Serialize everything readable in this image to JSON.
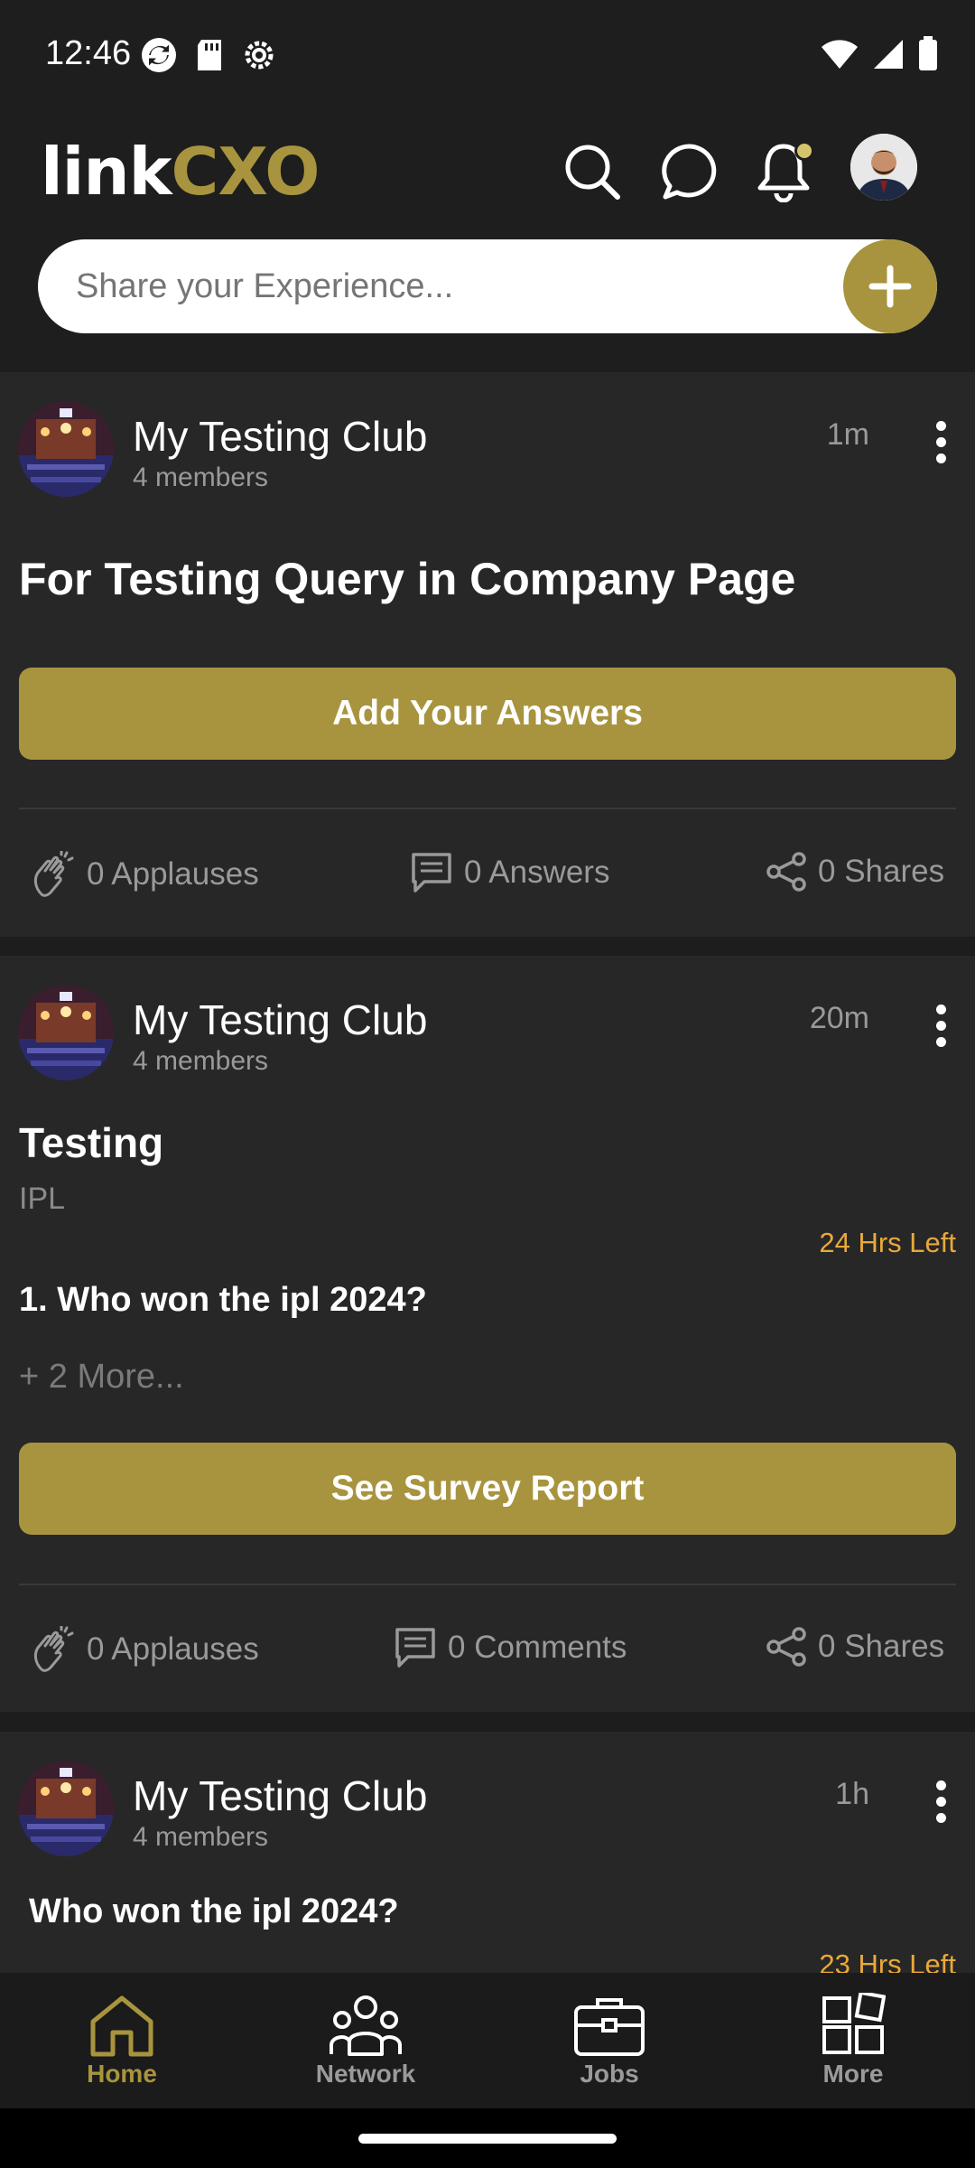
{
  "status_bar": {
    "time": "12:46"
  },
  "header": {
    "logo_left": "link",
    "logo_right": "CXO",
    "share_placeholder": "Share your Experience..."
  },
  "colors": {
    "accent": "#a8943e",
    "card_bg": "#272727",
    "page_bg": "#1d1d1d",
    "deadline": "#e9a93a"
  },
  "posts": [
    {
      "club": "My Testing Club",
      "members": "4 members",
      "time": "1m",
      "title": "For Testing Query in Company Page",
      "button": "Add Your Answers",
      "stats": {
        "applauses": "0 Applauses",
        "answers": "0 Answers",
        "shares": "0 Shares"
      }
    },
    {
      "club": "My Testing Club",
      "members": "4 members",
      "time": "20m",
      "title": "Testing",
      "subtitle": "IPL",
      "deadline": "24 Hrs Left",
      "question": "1. Who won the ipl 2024?",
      "more": "+ 2 More...",
      "button": "See Survey Report",
      "stats": {
        "applauses": "0 Applauses",
        "comments": "0 Comments",
        "shares": "0 Shares"
      }
    },
    {
      "club": "My Testing Club",
      "members": "4 members",
      "time": "1h",
      "question": "Who won the ipl 2024?",
      "deadline": "23 Hrs Left"
    }
  ],
  "bottom_nav": [
    {
      "label": "Home",
      "icon": "home-icon",
      "active": true
    },
    {
      "label": "Network",
      "icon": "network-icon",
      "active": false
    },
    {
      "label": "Jobs",
      "icon": "briefcase-icon",
      "active": false
    },
    {
      "label": "More",
      "icon": "grid-icon",
      "active": false
    }
  ]
}
